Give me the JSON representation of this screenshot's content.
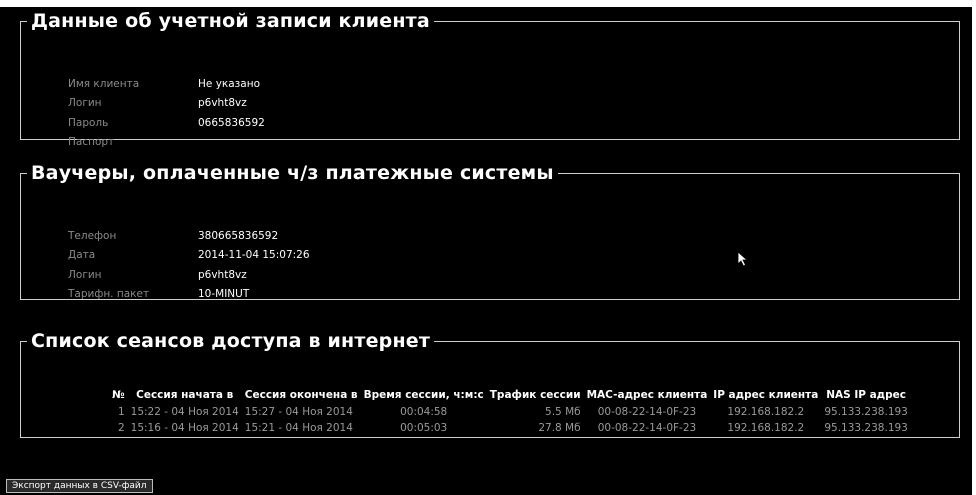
{
  "account": {
    "title": "Данные об учетной записи клиента",
    "fields": [
      {
        "label": "Имя клиента",
        "value": "Не указано"
      },
      {
        "label": "Логин",
        "value": "p6vht8vz"
      },
      {
        "label": "Пароль",
        "value": "0665836592"
      },
      {
        "label": "Паспорт",
        "value": ""
      }
    ]
  },
  "vouchers": {
    "title": "Ваучеры, оплаченные ч/з платежные системы",
    "fields": [
      {
        "label": "Телефон",
        "value": "380665836592"
      },
      {
        "label": "Дата",
        "value": "2014-11-04 15:07:26"
      },
      {
        "label": "Логин",
        "value": "p6vht8vz"
      },
      {
        "label": "Тарифн. пакет",
        "value": "10-MINUT"
      }
    ]
  },
  "sessions": {
    "title": "Список сеансов доступа в интернет",
    "headers": [
      "№",
      "Сессия начата в",
      "Сессия окончена в",
      "Время сессии, ч:м:с",
      "Трафик сессии",
      "MAC-адрес клиента",
      "IP адрес клиента",
      "NAS IP адрес"
    ],
    "rows": [
      [
        "1",
        "15:22 - 04 Ноя 2014",
        "15:27 - 04 Ноя 2014",
        "00:04:58",
        "5.5 Мб",
        "00-08-22-14-0F-23",
        "192.168.182.2",
        "95.133.238.193"
      ],
      [
        "2",
        "15:16 - 04 Ноя 2014",
        "15:21 - 04 Ноя 2014",
        "00:05:03",
        "27.8 Мб",
        "00-08-22-14-0F-23",
        "192.168.182.2",
        "95.133.238.193"
      ]
    ]
  },
  "export_button": "Экспорт данных в CSV-файл"
}
